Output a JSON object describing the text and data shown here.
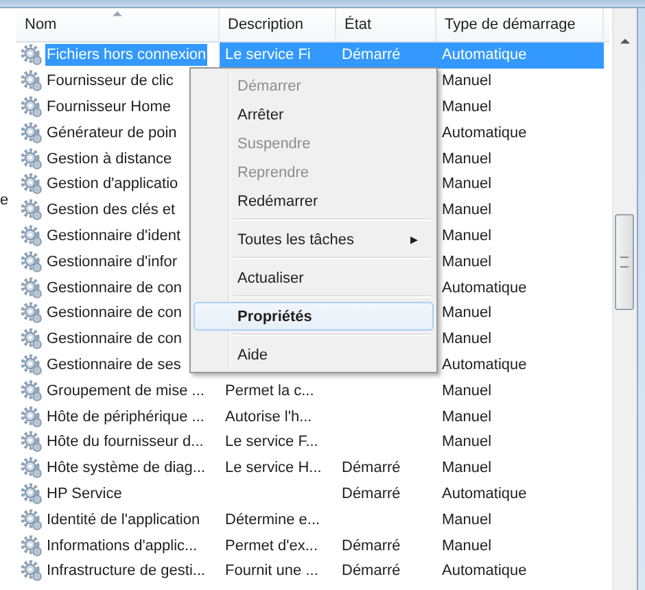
{
  "left_pane": {
    "fragment": "e"
  },
  "columns": [
    {
      "label": "Nom",
      "sorted": true
    },
    {
      "label": "Description",
      "sorted": false
    },
    {
      "label": "État",
      "sorted": false
    },
    {
      "label": "Type de démarrage",
      "sorted": false
    }
  ],
  "rows": [
    {
      "name": "Fichiers hors connexion",
      "description": "Le service Fi",
      "state": "Démarré",
      "startup": "Automatique",
      "selected": true
    },
    {
      "name": "Fournisseur de clic",
      "startup": "Manuel",
      "selected": false
    },
    {
      "name": "Fournisseur Home",
      "startup": "Manuel",
      "selected": false
    },
    {
      "name": "Générateur de poin",
      "startup": "Automatique",
      "selected": false
    },
    {
      "name": "Gestion à distance",
      "startup": "Manuel",
      "selected": false
    },
    {
      "name": "Gestion d'applicatio",
      "startup": "Manuel",
      "selected": false
    },
    {
      "name": "Gestion des clés et",
      "startup": "Manuel",
      "selected": false
    },
    {
      "name": "Gestionnaire d'ident",
      "startup": "Manuel",
      "selected": false
    },
    {
      "name": "Gestionnaire d'infor",
      "startup": "Manuel",
      "selected": false
    },
    {
      "name": "Gestionnaire de con",
      "startup": "Automatique",
      "selected": false
    },
    {
      "name": "Gestionnaire de con",
      "startup": "Manuel",
      "selected": false
    },
    {
      "name": "Gestionnaire de con",
      "startup": "Manuel",
      "selected": false
    },
    {
      "name": "Gestionnaire de ses",
      "startup": "Automatique",
      "selected": false
    },
    {
      "name": "Groupement de mise ...",
      "description": "Permet la c...",
      "startup": "Manuel",
      "selected": false
    },
    {
      "name": "Hôte de périphérique ...",
      "description": "Autorise l'h...",
      "startup": "Manuel",
      "selected": false
    },
    {
      "name": "Hôte du fournisseur d...",
      "description": "Le service F...",
      "startup": "Manuel",
      "selected": false
    },
    {
      "name": "Hôte système de diag...",
      "description": "Le service H...",
      "state": "Démarré",
      "startup": "Manuel",
      "selected": false
    },
    {
      "name": "HP Service",
      "state": "Démarré",
      "startup": "Automatique",
      "selected": false
    },
    {
      "name": "Identité de l'application",
      "description": "Détermine e...",
      "startup": "Manuel",
      "selected": false
    },
    {
      "name": "Informations d'applic...",
      "description": "Permet d'ex...",
      "state": "Démarré",
      "startup": "Manuel",
      "selected": false
    },
    {
      "name": "Infrastructure de gesti...",
      "description": "Fournit une ...",
      "state": "Démarré",
      "startup": "Automatique",
      "selected": false
    }
  ],
  "context_menu": [
    {
      "kind": "item",
      "label": "Démarrer",
      "disabled": true,
      "selected": false
    },
    {
      "kind": "item",
      "label": "Arrêter",
      "disabled": false,
      "selected": false
    },
    {
      "kind": "item",
      "label": "Suspendre",
      "disabled": true,
      "selected": false
    },
    {
      "kind": "item",
      "label": "Reprendre",
      "disabled": true,
      "selected": false
    },
    {
      "kind": "item",
      "label": "Redémarrer",
      "disabled": false,
      "selected": false
    },
    {
      "kind": "separator"
    },
    {
      "kind": "submenu",
      "label": "Toutes les tâches",
      "arrow": "▸",
      "disabled": false,
      "selected": false
    },
    {
      "kind": "separator"
    },
    {
      "kind": "item",
      "label": "Actualiser",
      "disabled": false,
      "selected": false
    },
    {
      "kind": "separator"
    },
    {
      "kind": "default",
      "label": "Propriétés",
      "disabled": false,
      "selected": true
    },
    {
      "kind": "separator"
    },
    {
      "kind": "item",
      "label": "Aide",
      "disabled": false,
      "selected": false
    }
  ]
}
